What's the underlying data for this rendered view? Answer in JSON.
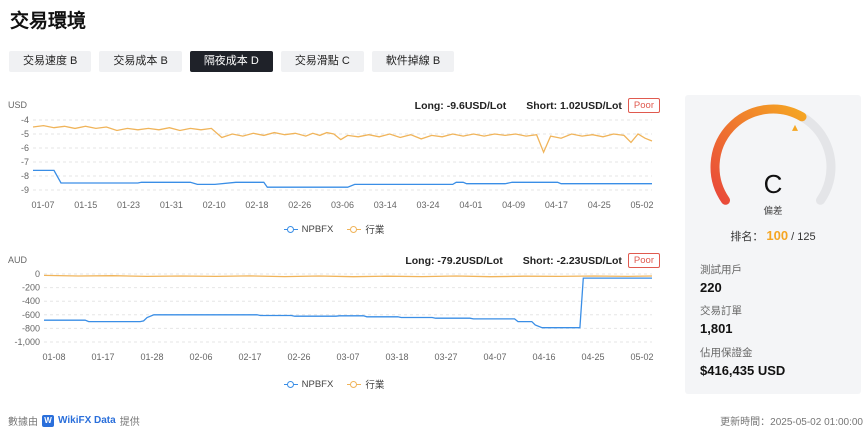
{
  "page": {
    "title": "交易環境"
  },
  "tabs": [
    {
      "label": "交易速度 B",
      "active": false
    },
    {
      "label": "交易成本 B",
      "active": false
    },
    {
      "label": "隔夜成本 D",
      "active": true
    },
    {
      "label": "交易滑點 C",
      "active": false
    },
    {
      "label": "軟件掉線 B",
      "active": false
    }
  ],
  "charts": [
    {
      "unit": "USD",
      "long": "Long: -9.6USD/Lot",
      "short": "Short: 1.02USD/Lot",
      "badge": "Poor",
      "legend": [
        "NPBFX",
        "行業"
      ]
    },
    {
      "unit": "AUD",
      "long": "Long: -79.2USD/Lot",
      "short": "Short: -2.23USD/Lot",
      "badge": "Poor",
      "legend": [
        "NPBFX",
        "行業"
      ]
    }
  ],
  "chart_data": [
    {
      "type": "line",
      "ylabel": "USD",
      "ylim": [
        -9,
        -4
      ],
      "yticks": [
        "-4",
        "-5",
        "-6",
        "-7",
        "-8",
        "-9"
      ],
      "xticks": [
        "01-07",
        "01-15",
        "01-23",
        "01-31",
        "02-10",
        "02-18",
        "02-26",
        "03-06",
        "03-14",
        "03-24",
        "04-01",
        "04-09",
        "04-17",
        "04-25",
        "05-02"
      ],
      "series": [
        {
          "name": "NPBFX",
          "color": "#3a8ee6",
          "points": [
            [
              0,
              -7.6
            ],
            [
              6,
              -7.6
            ],
            [
              8,
              -8.5
            ],
            [
              30,
              -8.5
            ],
            [
              31,
              -8.45
            ],
            [
              45,
              -8.45
            ],
            [
              47,
              -8.6
            ],
            [
              52,
              -8.6
            ],
            [
              58,
              -8.45
            ],
            [
              66,
              -8.45
            ],
            [
              67,
              -8.8
            ],
            [
              90,
              -8.8
            ],
            [
              92,
              -8.6
            ],
            [
              120,
              -8.6
            ],
            [
              121,
              -8.45
            ],
            [
              123,
              -8.45
            ],
            [
              124,
              -8.55
            ],
            [
              135,
              -8.55
            ],
            [
              137,
              -8.45
            ],
            [
              150,
              -8.45
            ],
            [
              151,
              -8.55
            ],
            [
              177,
              -8.55
            ]
          ]
        },
        {
          "name": "行業",
          "color": "#f0b45a",
          "points": [
            [
              0,
              -4.5
            ],
            [
              3,
              -4.4
            ],
            [
              6,
              -4.55
            ],
            [
              9,
              -4.45
            ],
            [
              12,
              -4.6
            ],
            [
              15,
              -4.45
            ],
            [
              18,
              -4.6
            ],
            [
              21,
              -4.5
            ],
            [
              24,
              -4.75
            ],
            [
              27,
              -4.6
            ],
            [
              30,
              -4.7
            ],
            [
              33,
              -4.6
            ],
            [
              36,
              -4.7
            ],
            [
              39,
              -4.55
            ],
            [
              42,
              -4.75
            ],
            [
              45,
              -4.6
            ],
            [
              48,
              -4.7
            ],
            [
              51,
              -4.6
            ],
            [
              54,
              -5.25
            ],
            [
              57,
              -5.0
            ],
            [
              60,
              -5.15
            ],
            [
              63,
              -4.95
            ],
            [
              66,
              -5.1
            ],
            [
              69,
              -4.9
            ],
            [
              72,
              -5.05
            ],
            [
              75,
              -4.95
            ],
            [
              78,
              -5.15
            ],
            [
              80,
              -4.95
            ],
            [
              82,
              -5.1
            ],
            [
              84,
              -4.9
            ],
            [
              86,
              -5.0
            ],
            [
              88,
              -5.4
            ],
            [
              90,
              -5.1
            ],
            [
              93,
              -5.2
            ],
            [
              96,
              -5.05
            ],
            [
              99,
              -5.2
            ],
            [
              102,
              -5.0
            ],
            [
              105,
              -5.25
            ],
            [
              108,
              -5.05
            ],
            [
              111,
              -5.35
            ],
            [
              114,
              -5.1
            ],
            [
              117,
              -5.2
            ],
            [
              120,
              -5.0
            ],
            [
              123,
              -5.15
            ],
            [
              126,
              -5.0
            ],
            [
              129,
              -5.15
            ],
            [
              132,
              -5.0
            ],
            [
              135,
              -5.1
            ],
            [
              138,
              -5.0
            ],
            [
              141,
              -5.15
            ],
            [
              144,
              -5.05
            ],
            [
              146,
              -6.3
            ],
            [
              148,
              -5.15
            ],
            [
              151,
              -5.3
            ],
            [
              154,
              -5.0
            ],
            [
              157,
              -5.15
            ],
            [
              160,
              -5.05
            ],
            [
              163,
              -5.2
            ],
            [
              166,
              -5.0
            ],
            [
              169,
              -5.1
            ],
            [
              171,
              -5.6
            ],
            [
              173,
              -5.0
            ],
            [
              175,
              -5.3
            ],
            [
              177,
              -5.5
            ]
          ]
        }
      ]
    },
    {
      "type": "line",
      "ylabel": "AUD",
      "ylim": [
        -1000,
        0
      ],
      "yticks": [
        "0",
        "-200",
        "-400",
        "-600",
        "-800",
        "-1,000"
      ],
      "xticks": [
        "01-08",
        "01-17",
        "01-28",
        "02-06",
        "02-17",
        "02-26",
        "03-07",
        "03-18",
        "03-27",
        "04-07",
        "04-16",
        "04-25",
        "05-02"
      ],
      "series": [
        {
          "name": "NPBFX",
          "color": "#3a8ee6",
          "points": [
            [
              0,
              -680
            ],
            [
              12,
              -680
            ],
            [
              13,
              -700
            ],
            [
              28,
              -700
            ],
            [
              29,
              -690
            ],
            [
              30,
              -640
            ],
            [
              32,
              -600
            ],
            [
              62,
              -600
            ],
            [
              63,
              -610
            ],
            [
              72,
              -610
            ],
            [
              73,
              -620
            ],
            [
              85,
              -620
            ],
            [
              86,
              -615
            ],
            [
              93,
              -615
            ],
            [
              94,
              -630
            ],
            [
              103,
              -630
            ],
            [
              104,
              -640
            ],
            [
              113,
              -640
            ],
            [
              114,
              -650
            ],
            [
              124,
              -650
            ],
            [
              125,
              -660
            ],
            [
              137,
              -660
            ],
            [
              138,
              -700
            ],
            [
              142,
              -700
            ],
            [
              143,
              -750
            ],
            [
              145,
              -790
            ],
            [
              156,
              -790
            ],
            [
              157,
              -60
            ],
            [
              177,
              -60
            ]
          ]
        },
        {
          "name": "行業",
          "color": "#f0b45a",
          "points": [
            [
              0,
              -20
            ],
            [
              10,
              -30
            ],
            [
              20,
              -25
            ],
            [
              30,
              -35
            ],
            [
              40,
              -30
            ],
            [
              50,
              -35
            ],
            [
              60,
              -28
            ],
            [
              70,
              -38
            ],
            [
              80,
              -30
            ],
            [
              90,
              -40
            ],
            [
              100,
              -32
            ],
            [
              110,
              -38
            ],
            [
              120,
              -30
            ],
            [
              130,
              -40
            ],
            [
              140,
              -32
            ],
            [
              150,
              -35
            ],
            [
              160,
              -30
            ],
            [
              170,
              -35
            ],
            [
              177,
              -30
            ]
          ]
        }
      ]
    }
  ],
  "score": {
    "grade": "C",
    "grade_label": "偏差",
    "rank_label": "排名：",
    "rank_value": "100",
    "rank_total": "/ 125",
    "level": 0.62,
    "gauge_colors": [
      "#e9473a",
      "#f5a623"
    ]
  },
  "stats": [
    {
      "label": "測試用戶",
      "value": "220"
    },
    {
      "label": "交易訂單",
      "value": "1,801"
    },
    {
      "label": "佔用保證金",
      "value": "$416,435 USD"
    }
  ],
  "footer": {
    "source_prefix": "數據由",
    "brand": "WikiFX Data",
    "source_suffix": "提供",
    "updated": "更新時間：2025-05-02 01:00:00"
  }
}
